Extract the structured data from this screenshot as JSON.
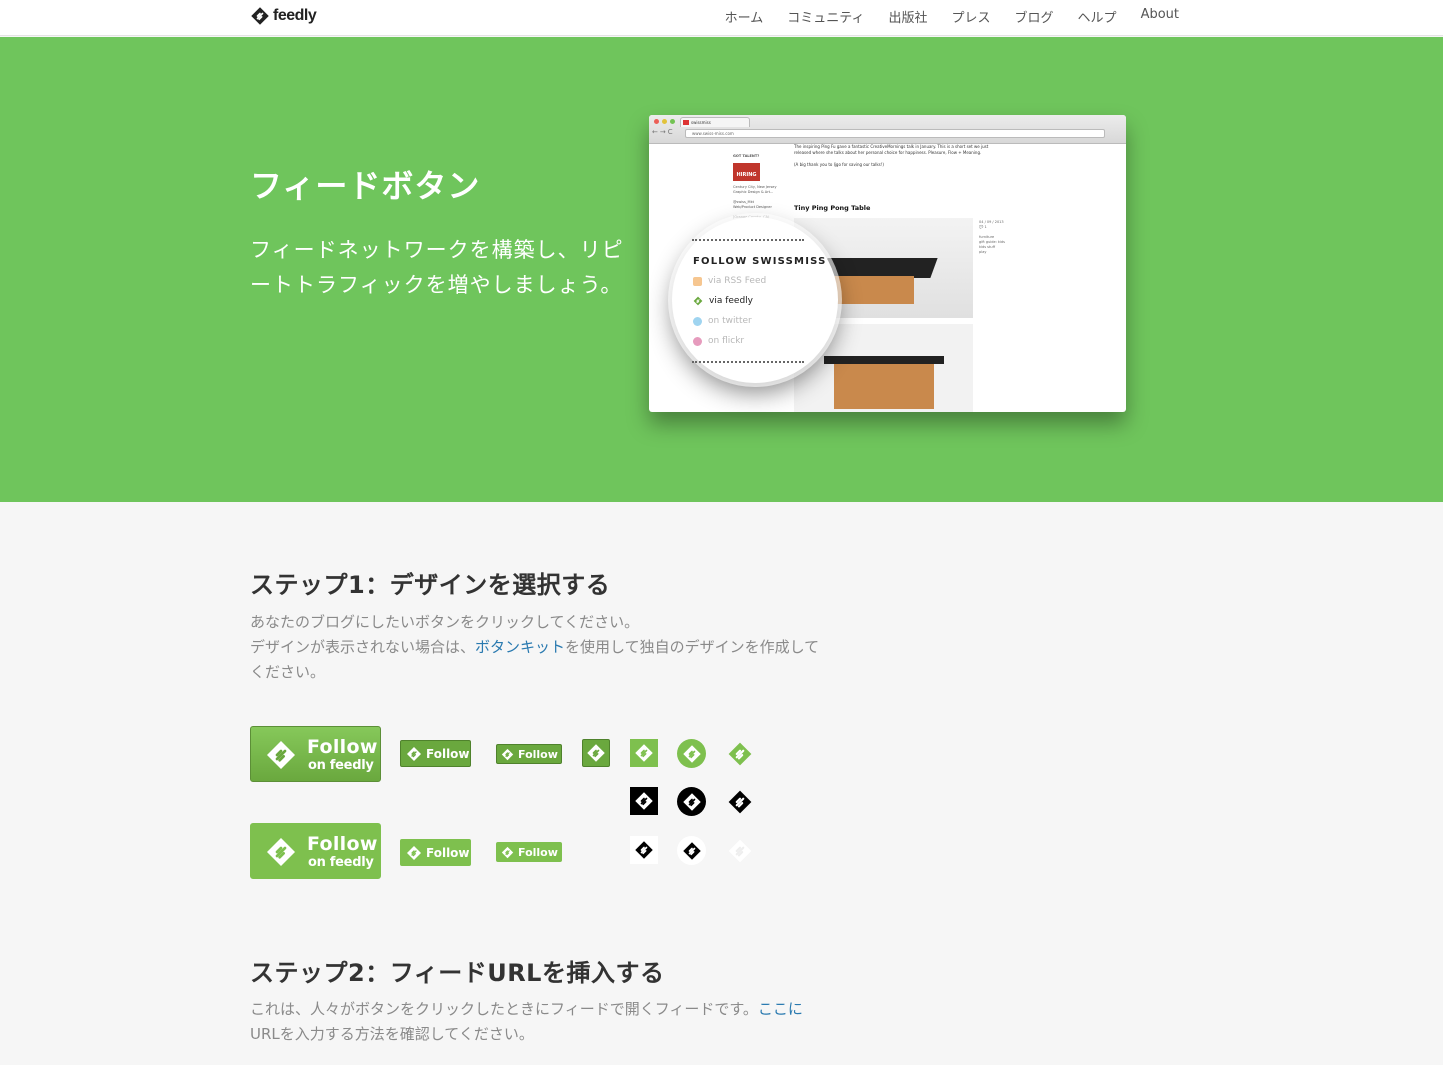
{
  "header": {
    "logo_text": "feedly",
    "nav": [
      "ホーム",
      "コミュニティ",
      "出版社",
      "プレス",
      "ブログ",
      "ヘルプ",
      "About"
    ]
  },
  "hero": {
    "title": "フィードボタン",
    "subtitle": "フィードネットワークを構築し、リピートトラフィックを増やしましょう。"
  },
  "mockup": {
    "tab_title": "swissmiss",
    "url": "www.swiss-miss.com",
    "sidebar_heading": "GOT TALENT?",
    "hiring_label": "HIRING",
    "sidebar_text": "Century City, New Jersey\nGraphic Design & Art...\n\n@swiss_Mkt\nWeb/Product Designer\n\n(Orange County, CA)\n@GoldBlackDesign\nSenior/Art Director",
    "post_text": "The inspiring Ping Fu gave a fantastic CreativeMornings talk in January. This is a short set we just released where she talks about her personal choice for happiness. Pleasure, Flow + Meaning.\n\n(A big thank you to Ijgo for saving our talks!)",
    "post_title": "Tiny Ping Pong Table",
    "meta_text": "04 / 09 / 2013\n💬 1\n\nfurniture\ngift guide: kids\nkids stuff\nplay"
  },
  "magnifier": {
    "title": "FOLLOW SWISSMISS",
    "items": [
      {
        "label": "via RSS Feed",
        "icon": "rss-icon",
        "color": "#f6c690"
      },
      {
        "label": "via feedly",
        "icon": "feedly-icon",
        "color": "#6aa83e"
      },
      {
        "label": "on twitter",
        "icon": "twitter-icon",
        "color": "#9fd4f0"
      },
      {
        "label": "on flickr",
        "icon": "flickr-icon",
        "color": "#e69bbd"
      }
    ]
  },
  "step1": {
    "title": "ステップ1：デザインを選択する",
    "line1": "あなたのブログにしたいボタンをクリックしてください。",
    "line2_a": "デザインが表示されない場合は、",
    "line2_link": "ボタンキット",
    "line2_b": "を使用して独自のデザインを作成して",
    "line3": "ください。"
  },
  "buttons": {
    "follow": "Follow",
    "on_feedly": "on feedly"
  },
  "step2": {
    "title": "ステップ2：フィードURLを挿入する",
    "line1_a": "これは、人々がボタンをクリックしたときにフィードで開くフィードです。",
    "line1_link": "ここに",
    "line2": "URLを入力する方法を確認してください。"
  },
  "colors": {
    "hero_green": "#6fc55c",
    "button_green": "#6aa83e",
    "link_blue": "#2a7ab0"
  }
}
